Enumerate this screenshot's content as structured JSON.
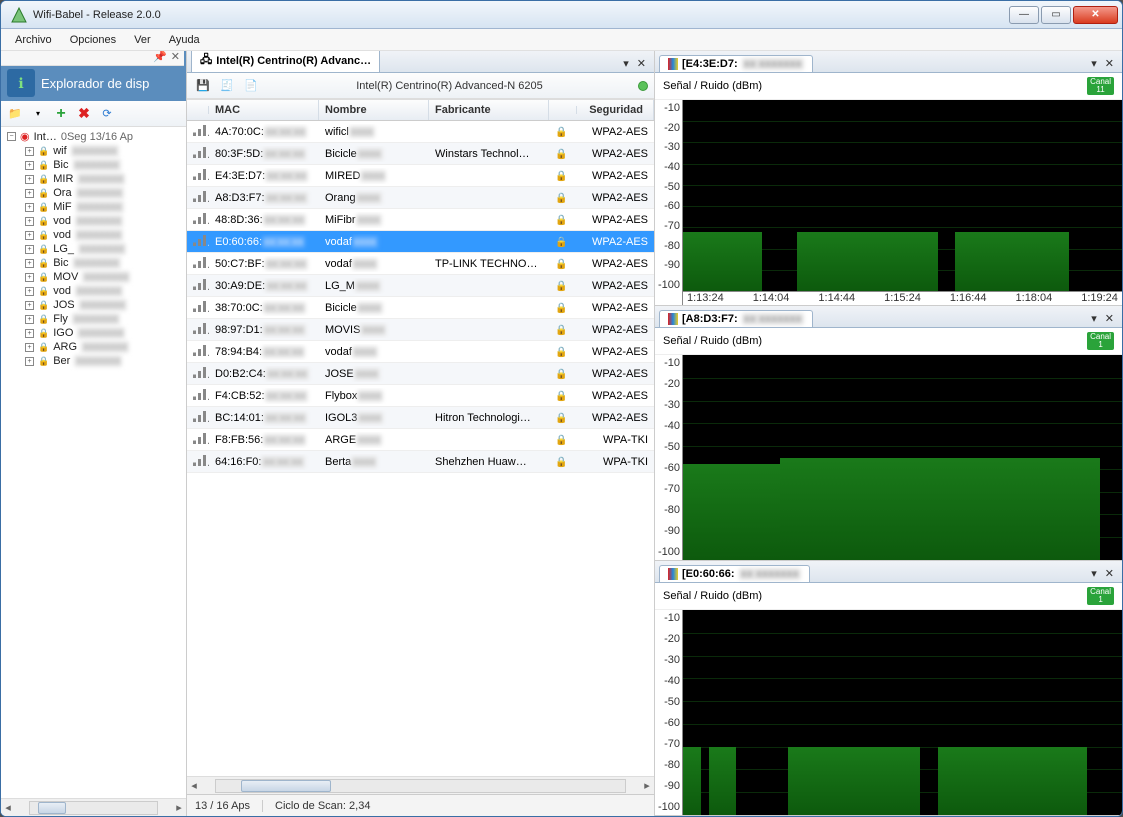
{
  "window": {
    "title": "Wifi-Babel - Release 2.0.0",
    "icon": "wifi-tower-icon"
  },
  "menu": {
    "file": "Archivo",
    "options": "Opciones",
    "view": "Ver",
    "help": "Ayuda"
  },
  "sidebar": {
    "header": "Explorador de disp",
    "root_label": "Int…",
    "root_meta": "0Seg 13/16 Ap",
    "items": [
      {
        "label": "wif"
      },
      {
        "label": "Bic"
      },
      {
        "label": "MIR"
      },
      {
        "label": "Ora"
      },
      {
        "label": "MiF"
      },
      {
        "label": "vod"
      },
      {
        "label": "vod"
      },
      {
        "label": "LG_"
      },
      {
        "label": "Bic"
      },
      {
        "label": "MOV"
      },
      {
        "label": "vod"
      },
      {
        "label": "JOS"
      },
      {
        "label": "Fly"
      },
      {
        "label": "IGO"
      },
      {
        "label": "ARG"
      },
      {
        "label": "Ber"
      }
    ]
  },
  "center": {
    "tab_label": "Intel(R) Centrino(R) Advanc…",
    "toolbar_label": "Intel(R) Centrino(R) Advanced-N 6205",
    "columns": {
      "mac": "MAC",
      "name": "Nombre",
      "manuf": "Fabricante",
      "sec": "Seguridad"
    },
    "rows": [
      {
        "mac": "4A:70:0C:",
        "name": "wificl",
        "manuf": "",
        "sec": "WPA2-AES"
      },
      {
        "mac": "80:3F:5D:",
        "name": "Bicicle",
        "manuf": "Winstars Technol…",
        "sec": "WPA2-AES"
      },
      {
        "mac": "E4:3E:D7:",
        "name": "MIRED",
        "manuf": "",
        "sec": "WPA2-AES"
      },
      {
        "mac": "A8:D3:F7:",
        "name": "Orang",
        "manuf": "",
        "sec": "WPA2-AES"
      },
      {
        "mac": "48:8D:36:",
        "name": "MiFibr",
        "manuf": "",
        "sec": "WPA2-AES"
      },
      {
        "mac": "E0:60:66:",
        "name": "vodaf",
        "manuf": "",
        "sec": "WPA2-AES",
        "selected": true
      },
      {
        "mac": "50:C7:BF:",
        "name": "vodaf",
        "manuf": "TP-LINK TECHNO…",
        "sec": "WPA2-AES"
      },
      {
        "mac": "30:A9:DE:",
        "name": "LG_M",
        "manuf": "",
        "sec": "WPA2-AES"
      },
      {
        "mac": "38:70:0C:",
        "name": "Bicicle",
        "manuf": "",
        "sec": "WPA2-AES"
      },
      {
        "mac": "98:97:D1:",
        "name": "MOVIS",
        "manuf": "",
        "sec": "WPA2-AES"
      },
      {
        "mac": "78:94:B4:",
        "name": "vodaf",
        "manuf": "",
        "sec": "WPA2-AES"
      },
      {
        "mac": "D0:B2:C4:",
        "name": "JOSE",
        "manuf": "",
        "sec": "WPA2-AES"
      },
      {
        "mac": "F4:CB:52:",
        "name": "Flybox",
        "manuf": "",
        "sec": "WPA2-AES"
      },
      {
        "mac": "BC:14:01:",
        "name": "IGOL3",
        "manuf": "Hitron Technologi…",
        "sec": "WPA2-AES"
      },
      {
        "mac": "F8:FB:56:",
        "name": "ARGE",
        "manuf": "",
        "sec": "WPA-TKI"
      },
      {
        "mac": "64:16:F0:",
        "name": "Berta",
        "manuf": "Shehzhen Huaw…",
        "sec": "WPA-TKI"
      }
    ],
    "status_aps": "13 / 16 Aps",
    "status_cycle": "Ciclo de Scan: 2,34"
  },
  "graphs": {
    "ylabel": "Señal / Ruido (dBm)",
    "panels": [
      {
        "title": "[E4:3E:D7:",
        "canal": "Canal",
        "canal_n": "11"
      },
      {
        "title": "[A8:D3:F7:",
        "canal": "Canal",
        "canal_n": "1"
      },
      {
        "title": "[E0:60:66:",
        "canal": "Canal",
        "canal_n": "1"
      }
    ],
    "xticks": [
      "1:13:24",
      "1:14:04",
      "1:14:44",
      "1:15:24",
      "1:16:44",
      "1:18:04",
      "1:19:24"
    ]
  },
  "chart_data": [
    {
      "type": "bar",
      "title": "[E4:3E:D7:…] Señal / Ruido (dBm)",
      "ylabel": "dBm",
      "ylim": [
        -100,
        -10
      ],
      "x": [
        "1:13:24",
        "1:14:04",
        "1:14:44",
        "1:15:24",
        "1:16:44",
        "1:18:04",
        "1:19:24"
      ],
      "series": [
        {
          "name": "Señal",
          "values_approx": -72,
          "pattern": "segments with gaps",
          "segments": [
            {
              "from": 0,
              "to": 18,
              "level": -72
            },
            {
              "from": 26,
              "to": 58,
              "level": -72
            },
            {
              "from": 62,
              "to": 88,
              "level": -72
            }
          ]
        }
      ]
    },
    {
      "type": "bar",
      "title": "[A8:D3:F7:…] Señal / Ruido (dBm)",
      "ylabel": "dBm",
      "ylim": [
        -100,
        -10
      ],
      "series": [
        {
          "name": "Señal",
          "values_approx": -58,
          "segments": [
            {
              "from": 0,
              "to": 22,
              "level": -58
            },
            {
              "from": 22,
              "to": 95,
              "level": -55
            }
          ]
        }
      ]
    },
    {
      "type": "bar",
      "title": "[E0:60:66:…] Señal / Ruido (dBm)",
      "ylabel": "dBm",
      "ylim": [
        -100,
        -10
      ],
      "series": [
        {
          "name": "Señal",
          "values_approx": -70,
          "segments": [
            {
              "from": 0,
              "to": 4,
              "level": -70
            },
            {
              "from": 6,
              "to": 12,
              "level": -70
            },
            {
              "from": 24,
              "to": 54,
              "level": -70
            },
            {
              "from": 58,
              "to": 92,
              "level": -70
            }
          ]
        }
      ]
    }
  ]
}
